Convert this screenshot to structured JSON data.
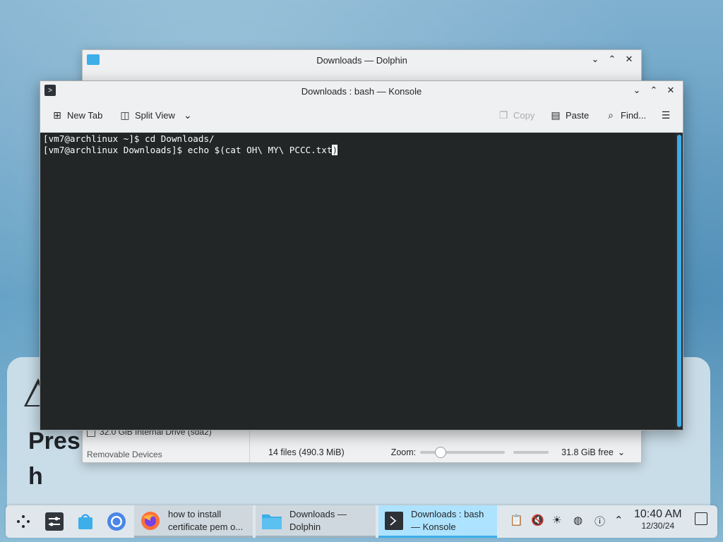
{
  "wallpaper": {
    "card_text_line1": "Pres",
    "card_text_line2": "h"
  },
  "dolphin": {
    "title": "Downloads — Dolphin",
    "drive_label": "32.0 GiB Internal Drive (sda2)",
    "removable_label": "Removable Devices",
    "status_files": "14 files (490.3 MiB)",
    "zoom_label": "Zoom:",
    "free_space": "31.8 GiB free",
    "zoom_level": 0.2
  },
  "konsole": {
    "title": "Downloads : bash — Konsole",
    "toolbar": {
      "new_tab": "New Tab",
      "split_view": "Split View",
      "copy": "Copy",
      "paste": "Paste",
      "find": "Find..."
    },
    "terminal_lines": [
      "[vm7@archlinux ~]$ cd Downloads/",
      "[vm7@archlinux Downloads]$ echo $(cat OH\\ MY\\ PCCC.txt"
    ],
    "cursor_char": ")"
  },
  "taskbar": {
    "tasks": [
      {
        "label_line1": "how to install",
        "label_line2": "certificate pem o..."
      },
      {
        "label_line1": "Downloads —",
        "label_line2": "Dolphin"
      },
      {
        "label_line1": "Downloads : bash",
        "label_line2": "— Konsole"
      }
    ],
    "clock_time": "10:40 AM",
    "clock_date": "12/30/24"
  },
  "colors": {
    "accent": "#3daee9",
    "terminal_bg": "#232627",
    "terminal_fg": "#fcfcfc"
  }
}
